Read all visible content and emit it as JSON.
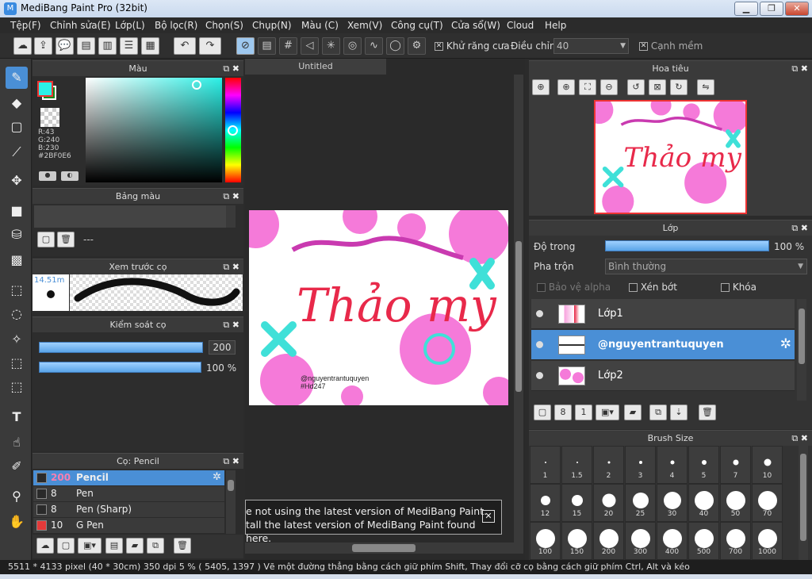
{
  "window": {
    "title": "MediBang Paint Pro (32bit)",
    "min": "▁",
    "max": "❐",
    "close": "✕"
  },
  "menu": [
    "Tệp(F)",
    "Chỉnh sửa(E)",
    "Lớp(L)",
    "Bộ lọc(R)",
    "Chọn(S)",
    "Chụp(N)",
    "Màu (C)",
    "Xem(V)",
    "Công cụ(T)",
    "Cửa sổ(W)",
    "Cloud",
    "Help"
  ],
  "toolbar": {
    "antialias_label": "Khử răng cưa",
    "correction_label": "Điều chỉnh",
    "correction_value": "40",
    "soft_edge_label": "Cạnh mềm"
  },
  "color_panel": {
    "title": "Màu",
    "r": "R:43",
    "g": "G:240",
    "b": "B:230",
    "hex": "#2BF0E6",
    "fg_color": "#2bf0e6",
    "bg_color": "#0e8a1a"
  },
  "palette_panel": {
    "title": "Bảng màu",
    "value": "---"
  },
  "brush_preview": {
    "title": "Xem trước cọ",
    "size": "14.51m"
  },
  "brush_control": {
    "title": "Kiểm soát cọ",
    "size_value": "200",
    "opacity_value": "100 %"
  },
  "brush_list": {
    "title": "Cọ: Pencil",
    "items": [
      {
        "size": "200",
        "name": "Pencil",
        "color": "#2a2a2a"
      },
      {
        "size": "8",
        "name": "Pen",
        "color": "#2a2a2a"
      },
      {
        "size": "8",
        "name": "Pen (Sharp)",
        "color": "#2a2a2a"
      },
      {
        "size": "10",
        "name": "G Pen",
        "color": "#e33a3a"
      }
    ]
  },
  "canvas": {
    "tab": "Untitled",
    "art_text": "Thảo my",
    "credit1": "@nguyentrantuquyen",
    "credit2": "#Hd247",
    "notice1": "e not using the latest version of MediBang Paint.",
    "notice2": "tall the latest version of MediBang Paint found here."
  },
  "navigator": {
    "title": "Hoa tiêu"
  },
  "layers": {
    "title": "Lớp",
    "opacity_label": "Độ trong",
    "opacity_value": "100 %",
    "opacity_level": 1.0,
    "blend_label": "Pha trộn",
    "blend_value": "Bình thường",
    "protect_alpha": "Bảo vệ alpha",
    "clipping": "Xén bớt",
    "lock": "Khóa",
    "items": [
      "Lớp1",
      "@nguyentrantuquyen",
      "Lớp2"
    ]
  },
  "brush_size": {
    "title": "Brush Size",
    "sizes": [
      "1",
      "1.5",
      "2",
      "3",
      "4",
      "5",
      "7",
      "10",
      "12",
      "15",
      "20",
      "25",
      "30",
      "40",
      "50",
      "70",
      "100",
      "150",
      "200",
      "300",
      "400",
      "500",
      "700",
      "1000"
    ]
  },
  "status": "5511 * 4133 pixel (40 * 30cm) 350 dpi 5 % ( 5405, 1397 ) Vẽ một đường thẳng bằng cách giữ phím Shift, Thay đổi cỡ cọ bằng cách giữ phím Ctrl, Alt và kéo"
}
